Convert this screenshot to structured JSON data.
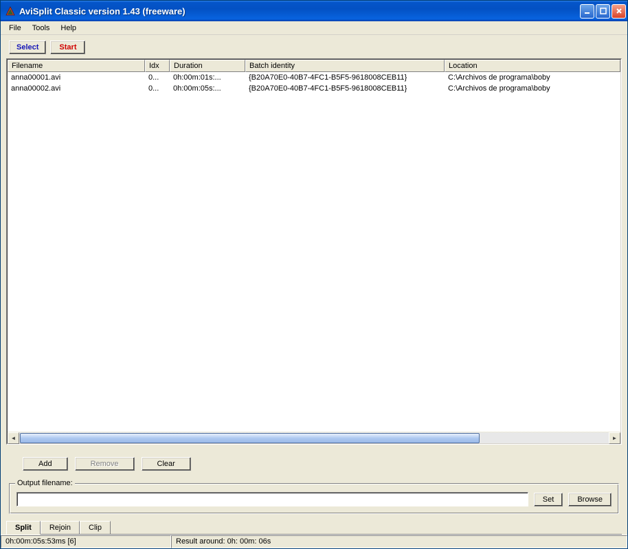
{
  "title": "AviSplit Classic version 1.43 (freeware)",
  "menu": {
    "file": "File",
    "tools": "Tools",
    "help": "Help"
  },
  "buttons": {
    "select": "Select",
    "start": "Start",
    "add": "Add",
    "remove": "Remove",
    "clear": "Clear",
    "set": "Set",
    "browse": "Browse"
  },
  "columns": {
    "filename": "Filename",
    "idx": "Idx",
    "duration": "Duration",
    "batch": "Batch identity",
    "location": "Location"
  },
  "columnWidths": {
    "filename": 200,
    "idx": 36,
    "duration": 110,
    "batch": 290,
    "location": 256
  },
  "rows": [
    {
      "filename": "anna00001.avi",
      "idx": "0...",
      "duration": "0h:00m:01s:...",
      "batch": "{B20A70E0-40B7-4FC1-B5F5-9618008CEB11}",
      "location": "C:\\Archivos de programa\\boby"
    },
    {
      "filename": "anna00002.avi",
      "idx": "0...",
      "duration": "0h:00m:05s:...",
      "batch": "{B20A70E0-40B7-4FC1-B5F5-9618008CEB11}",
      "location": "C:\\Archivos de programa\\boby"
    }
  ],
  "scroll": {
    "thumbPercent": 78
  },
  "output": {
    "legend": "Output filename:",
    "value": ""
  },
  "tabs": {
    "split": "Split",
    "rejoin": "Rejoin",
    "clip": "Clip"
  },
  "status": {
    "left": "0h:00m:05s:53ms [6]",
    "right": "Result around: 0h: 00m: 06s"
  }
}
